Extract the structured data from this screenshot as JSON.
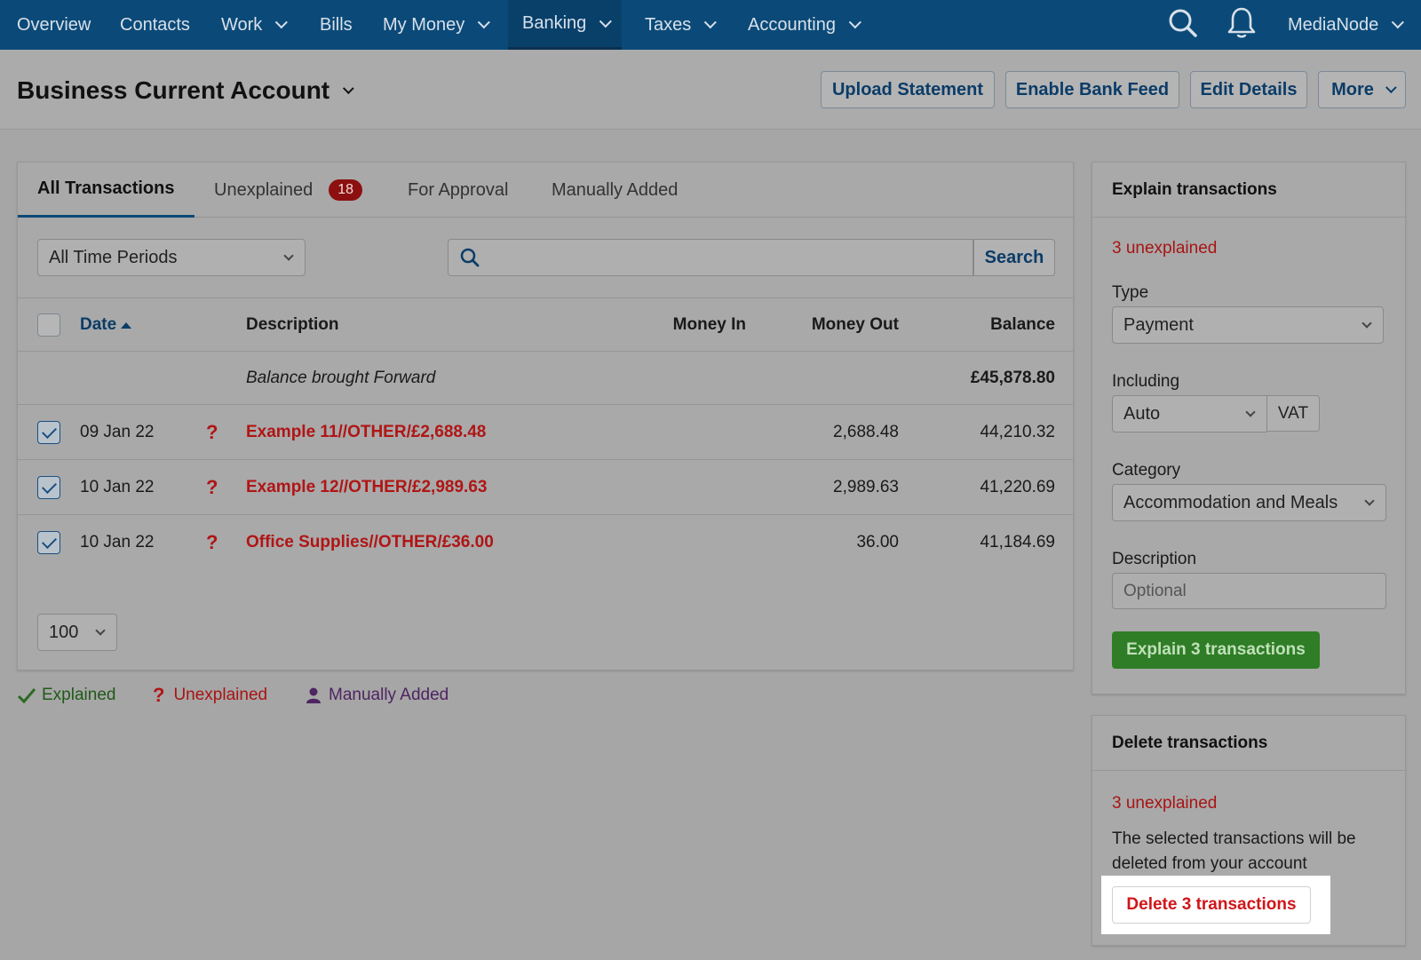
{
  "nav": {
    "items": [
      {
        "label": "Overview",
        "chevron": false
      },
      {
        "label": "Contacts",
        "chevron": false
      },
      {
        "label": "Work",
        "chevron": true
      },
      {
        "label": "Bills",
        "chevron": false
      },
      {
        "label": "My Money",
        "chevron": true
      },
      {
        "label": "Banking",
        "chevron": true,
        "active": true
      },
      {
        "label": "Taxes",
        "chevron": true
      },
      {
        "label": "Accounting",
        "chevron": true
      }
    ],
    "user": "MediaNode"
  },
  "header": {
    "title": "Business Current Account",
    "buttons": {
      "upload": "Upload Statement",
      "bank_feed": "Enable Bank Feed",
      "edit": "Edit Details",
      "more": "More"
    }
  },
  "tabs": {
    "all": "All Transactions",
    "unexplained": "Unexplained",
    "unexplained_count": "18",
    "approval": "For Approval",
    "manual": "Manually Added"
  },
  "filters": {
    "period": "All Time Periods",
    "search_placeholder": "",
    "search_button": "Search"
  },
  "table": {
    "headers": {
      "date": "Date",
      "description": "Description",
      "money_in": "Money In",
      "money_out": "Money Out",
      "balance": "Balance"
    },
    "brought_forward": {
      "label": "Balance brought Forward",
      "balance": "£45,878.80"
    },
    "rows": [
      {
        "date": "09 Jan 22",
        "status": "?",
        "description": "Example 11//OTHER/£2,688.48",
        "money_out": "2,688.48",
        "balance": "44,210.32"
      },
      {
        "date": "10 Jan 22",
        "status": "?",
        "description": "Example 12//OTHER/£2,989.63",
        "money_out": "2,989.63",
        "balance": "41,220.69"
      },
      {
        "date": "10 Jan 22",
        "status": "?",
        "description": "Office Supplies//OTHER/£36.00",
        "money_out": "36.00",
        "balance": "41,184.69"
      }
    ],
    "page_size": "100"
  },
  "legend": {
    "explained": "Explained",
    "unexplained": "Unexplained",
    "manual": "Manually Added"
  },
  "explain": {
    "title": "Explain transactions",
    "count_text": "3 unexplained",
    "type_label": "Type",
    "type_value": "Payment",
    "including_label": "Including",
    "including_value": "Auto",
    "vat_label": "VAT",
    "category_label": "Category",
    "category_value": "Accommodation and Meals",
    "description_label": "Description",
    "description_placeholder": "Optional",
    "button": "Explain 3 transactions"
  },
  "delete": {
    "title": "Delete transactions",
    "count_text": "3 unexplained",
    "message_line1": "The selected transactions will be",
    "message_line2": "deleted from your account",
    "button": "Delete 3 transactions"
  },
  "colors": {
    "nav_bg": "#0b4a78",
    "accent_blue": "#0b3c68",
    "unexplained_red": "#b01515",
    "explained_green": "#2f7d26",
    "manual_purple": "#5a2a6e",
    "delete_red": "#d0161a"
  }
}
